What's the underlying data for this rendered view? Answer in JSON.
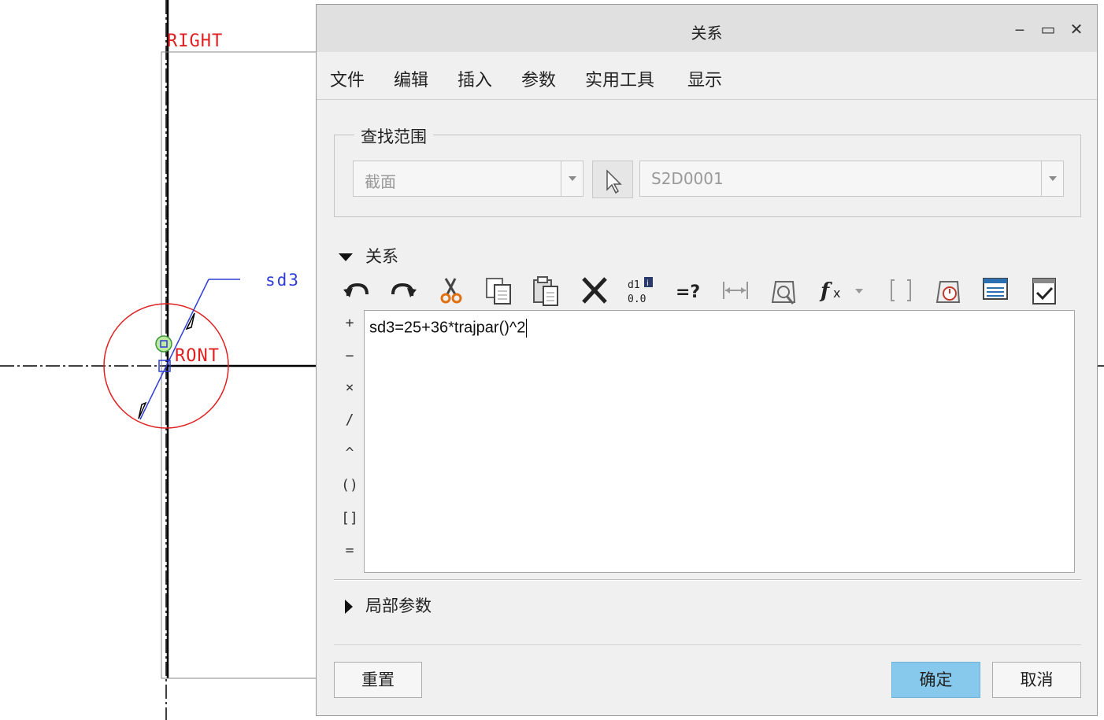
{
  "sketch": {
    "right_label": "RIGHT",
    "dimension_label": "sd3",
    "front_label": "RONT"
  },
  "dialog": {
    "title": "关系",
    "window_controls": {
      "minimize": "‒",
      "maximize": "▭",
      "close": "✕"
    },
    "menu": [
      "文件",
      "编辑",
      "插入",
      "参数",
      "实用工具",
      "显示"
    ],
    "lookup": {
      "title": "查找范围",
      "scope_value": "截面",
      "target_value": "S2D0001"
    },
    "relations": {
      "title": "关系",
      "toolbar_icons": [
        "undo-icon",
        "redo-icon",
        "cut-icon",
        "copy-icon",
        "paste-icon",
        "delete-icon",
        "switch-dimensions-icon",
        "evaluate-icon",
        "measure-icon",
        "properties-icon",
        "function-icon",
        "brackets-icon",
        "units-icon",
        "sort-icon",
        "verify-icon"
      ],
      "operators": [
        "+",
        "−",
        "×",
        "/",
        "^",
        "()",
        "[]",
        "="
      ],
      "expression": "sd3=25+36*trajpar()^2"
    },
    "local_params_title": "局部参数",
    "buttons": {
      "reset": "重置",
      "ok": "确定",
      "cancel": "取消"
    }
  }
}
